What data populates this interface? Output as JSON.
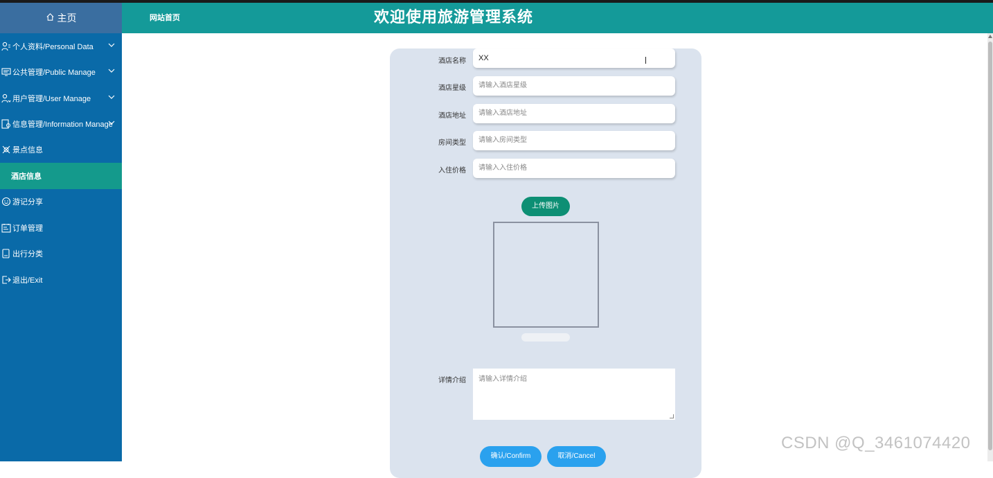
{
  "header": {
    "home_label": "主页",
    "site_home": "网站首页",
    "title": "欢迎使用旅游管理系统"
  },
  "sidebar": {
    "items": [
      {
        "label": "个人资料/Personal Data",
        "icon": "user-icon",
        "expandable": true
      },
      {
        "label": "公共管理/Public Manage",
        "icon": "monitor-icon",
        "expandable": true
      },
      {
        "label": "用户管理/User Manage",
        "icon": "users-icon",
        "expandable": true
      },
      {
        "label": "信息管理/Information Manage",
        "icon": "info-board-icon",
        "expandable": true
      },
      {
        "label": "景点信息",
        "icon": "scenic-icon",
        "expandable": false
      },
      {
        "label": "酒店信息",
        "icon": "",
        "expandable": false,
        "active": true
      },
      {
        "label": "游记分享",
        "icon": "share-icon",
        "expandable": false
      },
      {
        "label": "订单管理",
        "icon": "order-icon",
        "expandable": false
      },
      {
        "label": "出行分类",
        "icon": "category-icon",
        "expandable": false
      },
      {
        "label": "退出/Exit",
        "icon": "exit-icon",
        "expandable": false
      }
    ]
  },
  "form": {
    "hotel_name": {
      "label": "酒店名称",
      "value": "XX"
    },
    "hotel_star": {
      "label": "酒店星级",
      "placeholder": "请输入酒店星级"
    },
    "hotel_address": {
      "label": "酒店地址",
      "placeholder": "请输入酒店地址"
    },
    "room_type": {
      "label": "房间类型",
      "placeholder": "请输入房间类型"
    },
    "price": {
      "label": "入住价格",
      "placeholder": "请输入入住价格"
    },
    "upload_label": "上传图片",
    "detail": {
      "label": "详情介绍",
      "placeholder": "请输入详情介绍"
    },
    "confirm_label": "确认/Confirm",
    "cancel_label": "取消/Cancel"
  },
  "watermark": "CSDN @Q_3461074420",
  "colors": {
    "header": "#149a99",
    "sidebar": "#0a6aa8",
    "active_item": "#149a8c",
    "upload_button": "#0d8f74",
    "action_button": "#2aa1ee",
    "panel": "#dbe3ee"
  }
}
